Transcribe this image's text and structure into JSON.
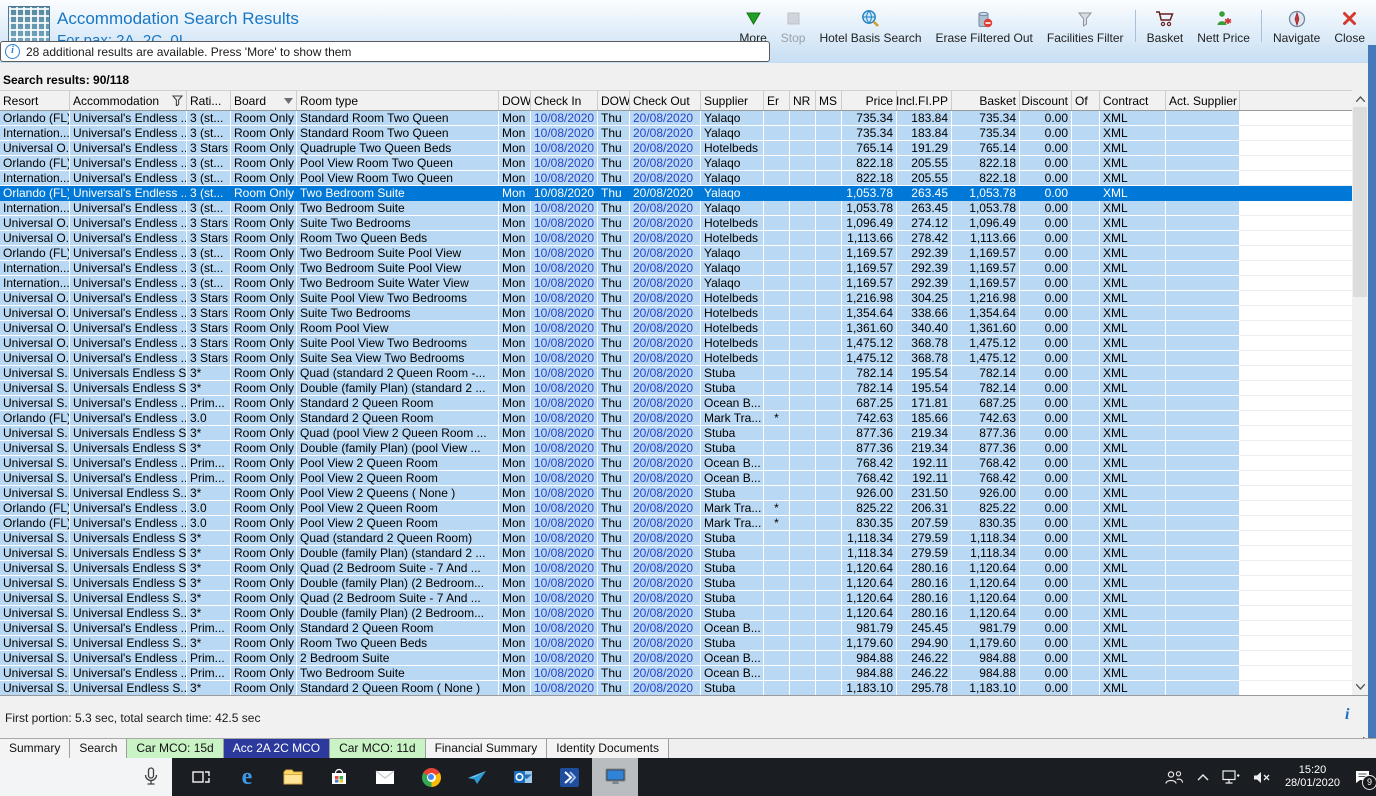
{
  "window": {
    "title": "Accommodation Search Results",
    "subtitle": "For pax: 2A, 2C, 0I"
  },
  "infobar": {
    "text": "28 additional results are available. Press 'More' to show them"
  },
  "results_label": "Search results: 90/118",
  "toolbar": {
    "items": [
      {
        "type": "button",
        "label": "More",
        "icon": "more",
        "enabled": true
      },
      {
        "type": "button",
        "label": "Stop",
        "icon": "stop",
        "enabled": false
      },
      {
        "type": "button",
        "label": "Hotel Basis Search",
        "icon": "hotel-basis-search",
        "enabled": true
      },
      {
        "type": "button",
        "label": "Erase Filtered Out",
        "icon": "erase-filtered-out",
        "enabled": true
      },
      {
        "type": "button",
        "label": "Facilities Filter",
        "icon": "facilities-filter",
        "enabled": true
      },
      {
        "type": "sep"
      },
      {
        "type": "button",
        "label": "Basket",
        "icon": "basket",
        "enabled": true
      },
      {
        "type": "button",
        "label": "Nett Price",
        "icon": "nett-price",
        "enabled": true
      },
      {
        "type": "sep"
      },
      {
        "type": "button",
        "label": "Navigate",
        "icon": "navigate",
        "enabled": true
      },
      {
        "type": "button",
        "label": "Close",
        "icon": "close",
        "enabled": true
      }
    ]
  },
  "table": {
    "selected_index": 5,
    "columns": [
      {
        "key": "resort",
        "label": "Resort"
      },
      {
        "key": "accommodation",
        "label": "Accommodation",
        "icon": "filter"
      },
      {
        "key": "rating",
        "label": "Rati..."
      },
      {
        "key": "board",
        "label": "Board",
        "icon": "dropdown"
      },
      {
        "key": "room-type",
        "label": "Room type"
      },
      {
        "key": "dow-in",
        "label": "DOW"
      },
      {
        "key": "check-in",
        "label": "Check In"
      },
      {
        "key": "dow-out",
        "label": "DOW"
      },
      {
        "key": "check-out",
        "label": "Check Out"
      },
      {
        "key": "supplier",
        "label": "Supplier"
      },
      {
        "key": "er",
        "label": "Er"
      },
      {
        "key": "nr",
        "label": "NR"
      },
      {
        "key": "ms",
        "label": "MS"
      },
      {
        "key": "price",
        "label": "Price"
      },
      {
        "key": "incl-fi-pp",
        "label": "Incl.FI.PP"
      },
      {
        "key": "basket",
        "label": "Basket"
      },
      {
        "key": "discount",
        "label": "Discount"
      },
      {
        "key": "of",
        "label": "Of"
      },
      {
        "key": "contract",
        "label": "Contract"
      },
      {
        "key": "act-supplier",
        "label": "Act. Supplier"
      }
    ],
    "rows": [
      [
        "Orlando (FL)",
        "Universal's Endless ...",
        "3 (st...",
        "Room Only",
        "Standard Room Two Queen",
        "Mon",
        "10/08/2020",
        "Thu",
        "20/08/2020",
        "Yalaqo",
        "",
        "",
        "",
        "735.34",
        "183.84",
        "735.34",
        "0.00",
        "",
        "XML",
        ""
      ],
      [
        "Internation...",
        "Universal's Endless ...",
        "3 (st...",
        "Room Only",
        "Standard Room Two Queen",
        "Mon",
        "10/08/2020",
        "Thu",
        "20/08/2020",
        "Yalaqo",
        "",
        "",
        "",
        "735.34",
        "183.84",
        "735.34",
        "0.00",
        "",
        "XML",
        ""
      ],
      [
        "Universal O...",
        "Universal's Endless ...",
        "3 Stars",
        "Room Only",
        "Quadruple Two Queen Beds",
        "Mon",
        "10/08/2020",
        "Thu",
        "20/08/2020",
        "Hotelbeds",
        "",
        "",
        "",
        "765.14",
        "191.29",
        "765.14",
        "0.00",
        "",
        "XML",
        ""
      ],
      [
        "Orlando (FL)",
        "Universal's Endless ...",
        "3 (st...",
        "Room Only",
        "Pool View Room Two Queen",
        "Mon",
        "10/08/2020",
        "Thu",
        "20/08/2020",
        "Yalaqo",
        "",
        "",
        "",
        "822.18",
        "205.55",
        "822.18",
        "0.00",
        "",
        "XML",
        ""
      ],
      [
        "Internation...",
        "Universal's Endless ...",
        "3 (st...",
        "Room Only",
        "Pool View Room Two Queen",
        "Mon",
        "10/08/2020",
        "Thu",
        "20/08/2020",
        "Yalaqo",
        "",
        "",
        "",
        "822.18",
        "205.55",
        "822.18",
        "0.00",
        "",
        "XML",
        ""
      ],
      [
        "Orlando (FL)",
        "Universal's Endless ...",
        "3 (st...",
        "Room Only",
        "Two Bedroom Suite",
        "Mon",
        "10/08/2020",
        "Thu",
        "20/08/2020",
        "Yalaqo",
        "",
        "",
        "",
        "1,053.78",
        "263.45",
        "1,053.78",
        "0.00",
        "",
        "XML",
        ""
      ],
      [
        "Internation...",
        "Universal's Endless ...",
        "3 (st...",
        "Room Only",
        "Two Bedroom Suite",
        "Mon",
        "10/08/2020",
        "Thu",
        "20/08/2020",
        "Yalaqo",
        "",
        "",
        "",
        "1,053.78",
        "263.45",
        "1,053.78",
        "0.00",
        "",
        "XML",
        ""
      ],
      [
        "Universal O...",
        "Universal's Endless ...",
        "3 Stars",
        "Room Only",
        "Suite Two Bedrooms",
        "Mon",
        "10/08/2020",
        "Thu",
        "20/08/2020",
        "Hotelbeds",
        "",
        "",
        "",
        "1,096.49",
        "274.12",
        "1,096.49",
        "0.00",
        "",
        "XML",
        ""
      ],
      [
        "Universal O...",
        "Universal's Endless ...",
        "3 Stars",
        "Room Only",
        "Room Two Queen Beds",
        "Mon",
        "10/08/2020",
        "Thu",
        "20/08/2020",
        "Hotelbeds",
        "",
        "",
        "",
        "1,113.66",
        "278.42",
        "1,113.66",
        "0.00",
        "",
        "XML",
        ""
      ],
      [
        "Orlando (FL)",
        "Universal's Endless ...",
        "3 (st...",
        "Room Only",
        "Two Bedroom Suite Pool View",
        "Mon",
        "10/08/2020",
        "Thu",
        "20/08/2020",
        "Yalaqo",
        "",
        "",
        "",
        "1,169.57",
        "292.39",
        "1,169.57",
        "0.00",
        "",
        "XML",
        ""
      ],
      [
        "Internation...",
        "Universal's Endless ...",
        "3 (st...",
        "Room Only",
        "Two Bedroom Suite Pool View",
        "Mon",
        "10/08/2020",
        "Thu",
        "20/08/2020",
        "Yalaqo",
        "",
        "",
        "",
        "1,169.57",
        "292.39",
        "1,169.57",
        "0.00",
        "",
        "XML",
        ""
      ],
      [
        "Internation...",
        "Universal's Endless ...",
        "3 (st...",
        "Room Only",
        "Two Bedroom Suite Water View",
        "Mon",
        "10/08/2020",
        "Thu",
        "20/08/2020",
        "Yalaqo",
        "",
        "",
        "",
        "1,169.57",
        "292.39",
        "1,169.57",
        "0.00",
        "",
        "XML",
        ""
      ],
      [
        "Universal O...",
        "Universal's Endless ...",
        "3 Stars",
        "Room Only",
        "Suite Pool View Two Bedrooms",
        "Mon",
        "10/08/2020",
        "Thu",
        "20/08/2020",
        "Hotelbeds",
        "",
        "",
        "",
        "1,216.98",
        "304.25",
        "1,216.98",
        "0.00",
        "",
        "XML",
        ""
      ],
      [
        "Universal O...",
        "Universal's Endless ...",
        "3 Stars",
        "Room Only",
        "Suite Two Bedrooms",
        "Mon",
        "10/08/2020",
        "Thu",
        "20/08/2020",
        "Hotelbeds",
        "",
        "",
        "",
        "1,354.64",
        "338.66",
        "1,354.64",
        "0.00",
        "",
        "XML",
        ""
      ],
      [
        "Universal O...",
        "Universal's Endless ...",
        "3 Stars",
        "Room Only",
        "Room Pool View",
        "Mon",
        "10/08/2020",
        "Thu",
        "20/08/2020",
        "Hotelbeds",
        "",
        "",
        "",
        "1,361.60",
        "340.40",
        "1,361.60",
        "0.00",
        "",
        "XML",
        ""
      ],
      [
        "Universal O...",
        "Universal's Endless ...",
        "3 Stars",
        "Room Only",
        "Suite Pool View Two Bedrooms",
        "Mon",
        "10/08/2020",
        "Thu",
        "20/08/2020",
        "Hotelbeds",
        "",
        "",
        "",
        "1,475.12",
        "368.78",
        "1,475.12",
        "0.00",
        "",
        "XML",
        ""
      ],
      [
        "Universal O...",
        "Universal's Endless ...",
        "3 Stars",
        "Room Only",
        "Suite Sea View Two Bedrooms",
        "Mon",
        "10/08/2020",
        "Thu",
        "20/08/2020",
        "Hotelbeds",
        "",
        "",
        "",
        "1,475.12",
        "368.78",
        "1,475.12",
        "0.00",
        "",
        "XML",
        ""
      ],
      [
        "Universal S...",
        "Universals Endless S...",
        "3*",
        "Room Only",
        "Quad (standard 2 Queen Room -...",
        "Mon",
        "10/08/2020",
        "Thu",
        "20/08/2020",
        "Stuba",
        "",
        "",
        "",
        "782.14",
        "195.54",
        "782.14",
        "0.00",
        "",
        "XML",
        ""
      ],
      [
        "Universal S...",
        "Universals Endless S...",
        "3*",
        "Room Only",
        "Double (family Plan) (standard 2 ...",
        "Mon",
        "10/08/2020",
        "Thu",
        "20/08/2020",
        "Stuba",
        "",
        "",
        "",
        "782.14",
        "195.54",
        "782.14",
        "0.00",
        "",
        "XML",
        ""
      ],
      [
        "Universal S...",
        "Universal's Endless ...",
        "Prim...",
        "Room Only",
        "Standard 2 Queen Room",
        "Mon",
        "10/08/2020",
        "Thu",
        "20/08/2020",
        "Ocean B...",
        "",
        "",
        "",
        "687.25",
        "171.81",
        "687.25",
        "0.00",
        "",
        "XML",
        ""
      ],
      [
        "Orlando (FL)",
        "Universal's Endless ...",
        "3.0",
        "Room Only",
        "Standard 2 Queen Room",
        "Mon",
        "10/08/2020",
        "Thu",
        "20/08/2020",
        "Mark Tra...",
        "*",
        "",
        "",
        "742.63",
        "185.66",
        "742.63",
        "0.00",
        "",
        "XML",
        ""
      ],
      [
        "Universal S...",
        "Universals Endless S...",
        "3*",
        "Room Only",
        "Quad (pool View 2 Queen Room ...",
        "Mon",
        "10/08/2020",
        "Thu",
        "20/08/2020",
        "Stuba",
        "",
        "",
        "",
        "877.36",
        "219.34",
        "877.36",
        "0.00",
        "",
        "XML",
        ""
      ],
      [
        "Universal S...",
        "Universals Endless S...",
        "3*",
        "Room Only",
        "Double (family Plan) (pool View ...",
        "Mon",
        "10/08/2020",
        "Thu",
        "20/08/2020",
        "Stuba",
        "",
        "",
        "",
        "877.36",
        "219.34",
        "877.36",
        "0.00",
        "",
        "XML",
        ""
      ],
      [
        "Universal S...",
        "Universal's Endless ...",
        "Prim...",
        "Room Only",
        "Pool View 2 Queen Room",
        "Mon",
        "10/08/2020",
        "Thu",
        "20/08/2020",
        "Ocean B...",
        "",
        "",
        "",
        "768.42",
        "192.11",
        "768.42",
        "0.00",
        "",
        "XML",
        ""
      ],
      [
        "Universal S...",
        "Universal's Endless ...",
        "Prim...",
        "Room Only",
        "Pool View 2 Queen Room",
        "Mon",
        "10/08/2020",
        "Thu",
        "20/08/2020",
        "Ocean B...",
        "",
        "",
        "",
        "768.42",
        "192.11",
        "768.42",
        "0.00",
        "",
        "XML",
        ""
      ],
      [
        "Universal S...",
        "Universal Endless S...",
        "3*",
        "Room Only",
        "Pool View 2 Queens ( None )",
        "Mon",
        "10/08/2020",
        "Thu",
        "20/08/2020",
        "Stuba",
        "",
        "",
        "",
        "926.00",
        "231.50",
        "926.00",
        "0.00",
        "",
        "XML",
        ""
      ],
      [
        "Orlando (FL)",
        "Universal's Endless ...",
        "3.0",
        "Room Only",
        "Pool View 2 Queen Room",
        "Mon",
        "10/08/2020",
        "Thu",
        "20/08/2020",
        "Mark Tra...",
        "*",
        "",
        "",
        "825.22",
        "206.31",
        "825.22",
        "0.00",
        "",
        "XML",
        ""
      ],
      [
        "Orlando (FL)",
        "Universal's Endless ...",
        "3.0",
        "Room Only",
        "Pool View 2 Queen Room",
        "Mon",
        "10/08/2020",
        "Thu",
        "20/08/2020",
        "Mark Tra...",
        "*",
        "",
        "",
        "830.35",
        "207.59",
        "830.35",
        "0.00",
        "",
        "XML",
        ""
      ],
      [
        "Universal S...",
        "Universals Endless S...",
        "3*",
        "Room Only",
        "Quad (standard 2 Queen Room)",
        "Mon",
        "10/08/2020",
        "Thu",
        "20/08/2020",
        "Stuba",
        "",
        "",
        "",
        "1,118.34",
        "279.59",
        "1,118.34",
        "0.00",
        "",
        "XML",
        ""
      ],
      [
        "Universal S...",
        "Universals Endless S...",
        "3*",
        "Room Only",
        "Double (family Plan) (standard 2 ...",
        "Mon",
        "10/08/2020",
        "Thu",
        "20/08/2020",
        "Stuba",
        "",
        "",
        "",
        "1,118.34",
        "279.59",
        "1,118.34",
        "0.00",
        "",
        "XML",
        ""
      ],
      [
        "Universal S...",
        "Universals Endless S...",
        "3*",
        "Room Only",
        "Quad (2 Bedroom Suite - 7 And ...",
        "Mon",
        "10/08/2020",
        "Thu",
        "20/08/2020",
        "Stuba",
        "",
        "",
        "",
        "1,120.64",
        "280.16",
        "1,120.64",
        "0.00",
        "",
        "XML",
        ""
      ],
      [
        "Universal S...",
        "Universals Endless S...",
        "3*",
        "Room Only",
        "Double (family Plan) (2 Bedroom...",
        "Mon",
        "10/08/2020",
        "Thu",
        "20/08/2020",
        "Stuba",
        "",
        "",
        "",
        "1,120.64",
        "280.16",
        "1,120.64",
        "0.00",
        "",
        "XML",
        ""
      ],
      [
        "Universal S...",
        "Universal Endless S...",
        "3*",
        "Room Only",
        "Quad (2 Bedroom Suite - 7 And ...",
        "Mon",
        "10/08/2020",
        "Thu",
        "20/08/2020",
        "Stuba",
        "",
        "",
        "",
        "1,120.64",
        "280.16",
        "1,120.64",
        "0.00",
        "",
        "XML",
        ""
      ],
      [
        "Universal S...",
        "Universal Endless S...",
        "3*",
        "Room Only",
        "Double (family Plan) (2 Bedroom...",
        "Mon",
        "10/08/2020",
        "Thu",
        "20/08/2020",
        "Stuba",
        "",
        "",
        "",
        "1,120.64",
        "280.16",
        "1,120.64",
        "0.00",
        "",
        "XML",
        ""
      ],
      [
        "Universal S...",
        "Universal's Endless ...",
        "Prim...",
        "Room Only",
        "Standard 2 Queen Room",
        "Mon",
        "10/08/2020",
        "Thu",
        "20/08/2020",
        "Ocean B...",
        "",
        "",
        "",
        "981.79",
        "245.45",
        "981.79",
        "0.00",
        "",
        "XML",
        ""
      ],
      [
        "Universal S...",
        "Universal Endless S...",
        "3*",
        "Room Only",
        "Room Two Queen Beds",
        "Mon",
        "10/08/2020",
        "Thu",
        "20/08/2020",
        "Stuba",
        "",
        "",
        "",
        "1,179.60",
        "294.90",
        "1,179.60",
        "0.00",
        "",
        "XML",
        ""
      ],
      [
        "Universal S...",
        "Universal's Endless ...",
        "Prim...",
        "Room Only",
        "2 Bedroom Suite",
        "Mon",
        "10/08/2020",
        "Thu",
        "20/08/2020",
        "Ocean B...",
        "",
        "",
        "",
        "984.88",
        "246.22",
        "984.88",
        "0.00",
        "",
        "XML",
        ""
      ],
      [
        "Universal S...",
        "Universal's Endless ...",
        "Prim...",
        "Room Only",
        "Two Bedroom Suite",
        "Mon",
        "10/08/2020",
        "Thu",
        "20/08/2020",
        "Ocean B...",
        "",
        "",
        "",
        "984.88",
        "246.22",
        "984.88",
        "0.00",
        "",
        "XML",
        ""
      ],
      [
        "Universal S...",
        "Universal Endless S...",
        "3*",
        "Room Only",
        "Standard 2 Queen Room ( None )",
        "Mon",
        "10/08/2020",
        "Thu",
        "20/08/2020",
        "Stuba",
        "",
        "",
        "",
        "1,183.10",
        "295.78",
        "1,183.10",
        "0.00",
        "",
        "XML",
        ""
      ]
    ]
  },
  "status": {
    "text": "First portion: 5.3 sec, total search time: 42.5 sec"
  },
  "tabs": {
    "items": [
      {
        "label": "Summary",
        "style": "normal"
      },
      {
        "label": "Search",
        "style": "normal"
      },
      {
        "label": "Car MCO: 15d",
        "style": "green"
      },
      {
        "label": "Acc 2A 2C MCO",
        "style": "selected"
      },
      {
        "label": "Car MCO: 11d",
        "style": "green"
      },
      {
        "label": "Financial Summary",
        "style": "normal"
      },
      {
        "label": "Identity Documents",
        "style": "normal"
      }
    ]
  },
  "taskbar": {
    "apps": [
      {
        "name": "task-view"
      },
      {
        "name": "edge"
      },
      {
        "name": "file-explorer"
      },
      {
        "name": "store"
      },
      {
        "name": "mail"
      },
      {
        "name": "chrome"
      },
      {
        "name": "flight-app"
      },
      {
        "name": "outlook"
      },
      {
        "name": "power-app"
      },
      {
        "name": "booking-app",
        "active": true
      }
    ],
    "clock": {
      "time": "15:20",
      "date": "28/01/2020"
    },
    "notification_count": "9"
  },
  "colors": {
    "selected_row": "#0078d7",
    "selected_tab": "#2b3a9c",
    "green_tab": "#c9f2c5",
    "date_text": "#2845c8",
    "title_text": "#1777c5",
    "row_blue": "#b9d8f3",
    "taskbar": "#1a1d21"
  }
}
